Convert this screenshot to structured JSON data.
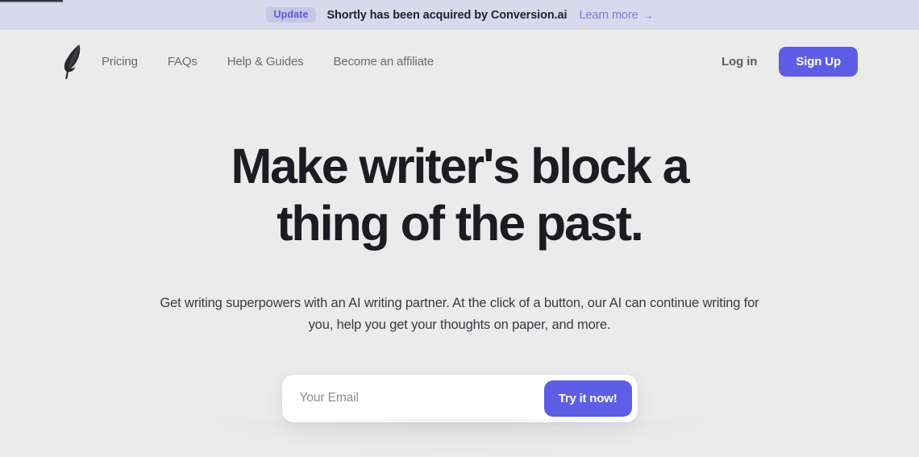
{
  "banner": {
    "badge_label": "Update",
    "message": "Shortly has been acquired by Conversion.ai",
    "link_label": "Learn more",
    "link_arrow": "→",
    "background_color": "#d8d9ec",
    "badge_background_color": "#c6c7e4",
    "badge_text_color": "#5b5bd6",
    "link_color": "#7b7ce0"
  },
  "header": {
    "logo_icon": "feather-quill-icon",
    "nav": [
      {
        "label": "Pricing"
      },
      {
        "label": "FAQs"
      },
      {
        "label": "Help & Guides"
      },
      {
        "label": "Become an affiliate"
      }
    ],
    "login_label": "Log in",
    "signup_label": "Sign Up",
    "accent_color": "#5d5de6"
  },
  "hero": {
    "headline": "Make writer's block a thing of the past.",
    "headline_line_1": "Make writer's block a",
    "headline_line_2": "thing of the past.",
    "subheadline": "Get writing superpowers with an AI writing partner. At the click of a button, our AI can continue writing for you, help you get your thoughts on paper, and more.",
    "headline_color": "#1c1d23"
  },
  "signup_form": {
    "email_placeholder": "Your Email",
    "email_value": "",
    "submit_label": "Try it now!",
    "submit_color": "#5d5de6"
  },
  "page": {
    "background_color": "#ebebeb"
  }
}
